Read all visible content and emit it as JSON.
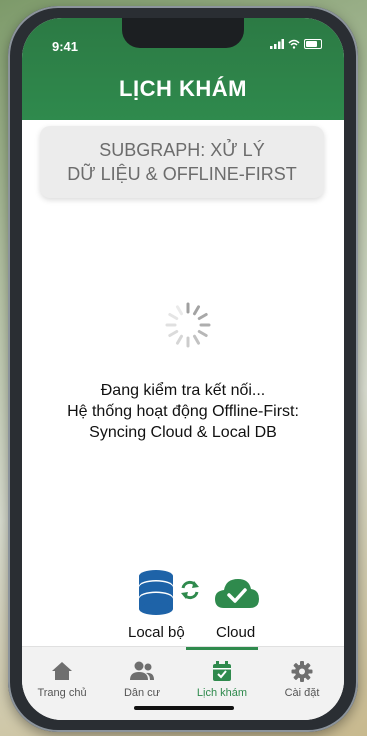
{
  "status_bar": {
    "time": "9:41"
  },
  "header": {
    "title": "LỊCH KHÁM"
  },
  "subgraph": {
    "line1": "SUBGRAPH: XỬ LÝ",
    "line2": "DỮ LIỆU & OFFLINE-FIRST"
  },
  "loading": {
    "line1": "Đang kiểm tra kết nối...",
    "line2": "Hệ thống hoạt động Offline-First:",
    "line3": "Syncing Cloud & Local DB"
  },
  "sync": {
    "local_label": "Local bộ",
    "cloud_label": "Cloud"
  },
  "tabs": [
    {
      "label": "Trang chủ",
      "icon": "home-icon"
    },
    {
      "label": "Dân cư",
      "icon": "users-icon"
    },
    {
      "label": "Lịch khám",
      "icon": "calendar-icon",
      "active": true
    },
    {
      "label": "Cài đặt",
      "icon": "gear-icon"
    }
  ],
  "colors": {
    "primary": "#2f8a4d",
    "header": "#2c7a44",
    "db_blue": "#1e63a8"
  }
}
